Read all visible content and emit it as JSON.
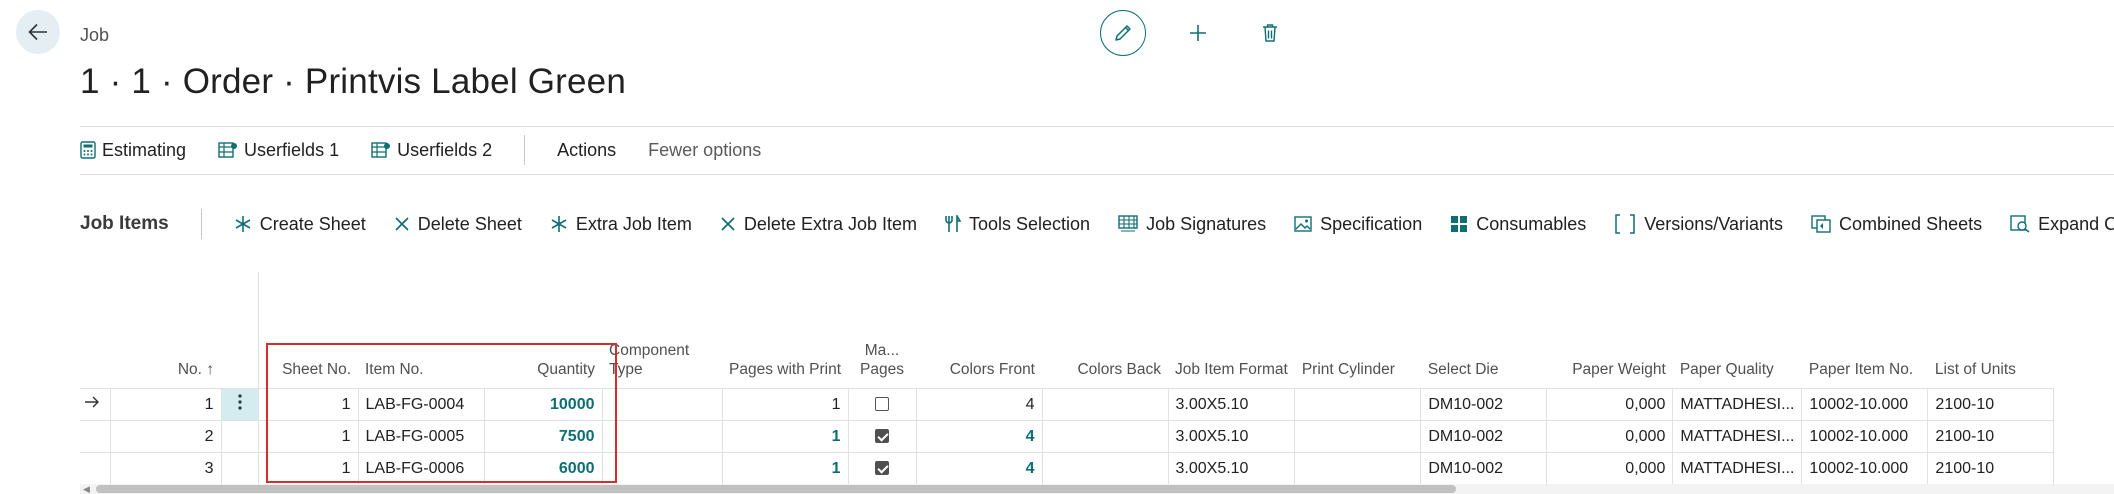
{
  "header": {
    "caption": "Job",
    "title": "1 · 1 · Order · Printvis Label Green"
  },
  "actionbar": {
    "items": [
      "Estimating",
      "Userfields 1",
      "Userfields 2"
    ],
    "actions": "Actions",
    "fewer": "Fewer options"
  },
  "part": {
    "title": "Job Items",
    "actions": [
      "Create Sheet",
      "Delete Sheet",
      "Extra Job Item",
      "Delete Extra Job Item",
      "Tools Selection",
      "Job Signatures",
      "Specification",
      "Consumables",
      "Versions/Variants",
      "Combined Sheets",
      "Expand Comp"
    ]
  },
  "grid": {
    "columns": [
      "No.",
      "Sheet No.",
      "Item No.",
      "Quantity",
      "Component Type",
      "Pages with Print",
      "Ma... Pages",
      "Colors Front",
      "Colors Back",
      "Job Item Format",
      "Print Cylinder",
      "Select Die",
      "Paper Weight",
      "Paper Quality",
      "Paper Item No.",
      "List of Units"
    ],
    "sort_indicator": "↑",
    "rows": [
      {
        "no": "1",
        "sheet": "1",
        "item": "LAB-FG-0004",
        "qty": "10000",
        "comp": "",
        "pages": "1",
        "ma": false,
        "colors_front": "4",
        "colors_back": "",
        "format": "3.00X5.10",
        "cyl": "",
        "die": "DM10-002",
        "weight": "0,000",
        "quality": "MATTADHESI...",
        "paper_item": "10002-10.000",
        "units": "2100-10"
      },
      {
        "no": "2",
        "sheet": "1",
        "item": "LAB-FG-0005",
        "qty": "7500",
        "comp": "",
        "pages": "1",
        "ma": true,
        "colors_front": "4",
        "colors_back": "",
        "format": "3.00X5.10",
        "cyl": "",
        "die": "DM10-002",
        "weight": "0,000",
        "quality": "MATTADHESI...",
        "paper_item": "10002-10.000",
        "units": "2100-10"
      },
      {
        "no": "3",
        "sheet": "1",
        "item": "LAB-FG-0006",
        "qty": "6000",
        "comp": "",
        "pages": "1",
        "ma": true,
        "colors_front": "4",
        "colors_back": "",
        "format": "3.00X5.10",
        "cyl": "",
        "die": "DM10-002",
        "weight": "0,000",
        "quality": "MATTADHESI...",
        "paper_item": "10002-10.000",
        "units": "2100-10"
      }
    ]
  },
  "colors": {
    "accent": "#0e6f72",
    "highlight": "#d32f2f",
    "selected_cell": "#d4ebef"
  }
}
